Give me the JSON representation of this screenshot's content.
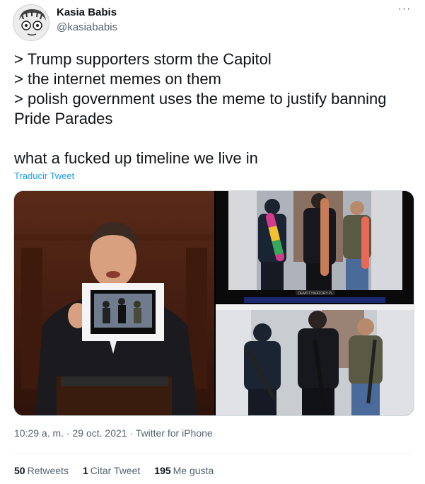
{
  "author": {
    "name": "Kasia Babis",
    "handle": "@kasiababis"
  },
  "menu": {
    "more_glyph": "···"
  },
  "tweet": {
    "lines": [
      "> Trump supporters storm the Capitol",
      "> the internet memes on them",
      "> polish government uses the meme to justify banning Pride Parades",
      "",
      "what a fucked up timeline we live in"
    ],
    "translate_label": "Traducir Tweet"
  },
  "media": {
    "watermark": "DEMOTYWATORY.PL"
  },
  "meta": {
    "time": "10:29 a. m.",
    "separator": "·",
    "date": "29 oct. 2021",
    "source": "Twitter for iPhone"
  },
  "stats": [
    {
      "count": "50",
      "label": "Retweets"
    },
    {
      "count": "1",
      "label": "Citar Tweet"
    },
    {
      "count": "195",
      "label": "Me gusta"
    }
  ],
  "colors": {
    "link": "#1d9bf0",
    "secondary_text": "#536471",
    "primary_text": "#0f1419"
  }
}
